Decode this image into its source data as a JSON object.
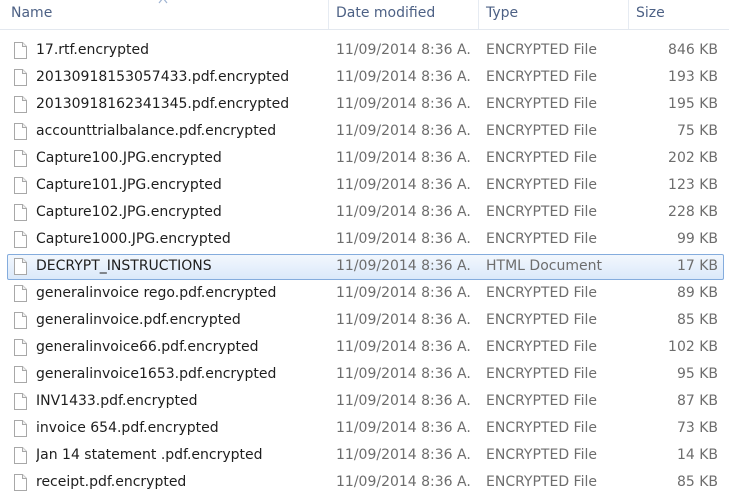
{
  "columns": {
    "name": "Name",
    "date": "Date modified",
    "type": "Type",
    "size": "Size"
  },
  "files": [
    {
      "name": "17.rtf.encrypted",
      "date": "11/09/2014 8:36 A...",
      "type": "ENCRYPTED File",
      "size": "846 KB",
      "selected": false
    },
    {
      "name": "20130918153057433.pdf.encrypted",
      "date": "11/09/2014 8:36 A...",
      "type": "ENCRYPTED File",
      "size": "193 KB",
      "selected": false
    },
    {
      "name": "20130918162341345.pdf.encrypted",
      "date": "11/09/2014 8:36 A...",
      "type": "ENCRYPTED File",
      "size": "195 KB",
      "selected": false
    },
    {
      "name": "accounttrialbalance.pdf.encrypted",
      "date": "11/09/2014 8:36 A...",
      "type": "ENCRYPTED File",
      "size": "75 KB",
      "selected": false
    },
    {
      "name": "Capture100.JPG.encrypted",
      "date": "11/09/2014 8:36 A...",
      "type": "ENCRYPTED File",
      "size": "202 KB",
      "selected": false
    },
    {
      "name": "Capture101.JPG.encrypted",
      "date": "11/09/2014 8:36 A...",
      "type": "ENCRYPTED File",
      "size": "123 KB",
      "selected": false
    },
    {
      "name": "Capture102.JPG.encrypted",
      "date": "11/09/2014 8:36 A...",
      "type": "ENCRYPTED File",
      "size": "228 KB",
      "selected": false
    },
    {
      "name": "Capture1000.JPG.encrypted",
      "date": "11/09/2014 8:36 A...",
      "type": "ENCRYPTED File",
      "size": "99 KB",
      "selected": false
    },
    {
      "name": "DECRYPT_INSTRUCTIONS",
      "date": "11/09/2014 8:36 A...",
      "type": "HTML Document",
      "size": "17 KB",
      "selected": true
    },
    {
      "name": "generalinvoice rego.pdf.encrypted",
      "date": "11/09/2014 8:36 A...",
      "type": "ENCRYPTED File",
      "size": "89 KB",
      "selected": false
    },
    {
      "name": "generalinvoice.pdf.encrypted",
      "date": "11/09/2014 8:36 A...",
      "type": "ENCRYPTED File",
      "size": "85 KB",
      "selected": false
    },
    {
      "name": "generalinvoice66.pdf.encrypted",
      "date": "11/09/2014 8:36 A...",
      "type": "ENCRYPTED File",
      "size": "102 KB",
      "selected": false
    },
    {
      "name": "generalinvoice1653.pdf.encrypted",
      "date": "11/09/2014 8:36 A...",
      "type": "ENCRYPTED File",
      "size": "95 KB",
      "selected": false
    },
    {
      "name": "INV1433.pdf.encrypted",
      "date": "11/09/2014 8:36 A...",
      "type": "ENCRYPTED File",
      "size": "87 KB",
      "selected": false
    },
    {
      "name": "invoice 654.pdf.encrypted",
      "date": "11/09/2014 8:36 A...",
      "type": "ENCRYPTED File",
      "size": "73 KB",
      "selected": false
    },
    {
      "name": "Jan 14 statement .pdf.encrypted",
      "date": "11/09/2014 8:36 A...",
      "type": "ENCRYPTED File",
      "size": "14 KB",
      "selected": false
    },
    {
      "name": "receipt.pdf.encrypted",
      "date": "11/09/2014 8:36 A...",
      "type": "ENCRYPTED File",
      "size": "85 KB",
      "selected": false
    }
  ],
  "icons": {
    "file": "blank-file-icon",
    "sort": "sort-up-arrow-icon"
  },
  "colors": {
    "header_text": "#4d6185",
    "name_text": "#1e1e1e",
    "meta_text": "#6d6d6d",
    "selection_border": "#84acdd",
    "selection_fill": "#dbe9fa"
  }
}
